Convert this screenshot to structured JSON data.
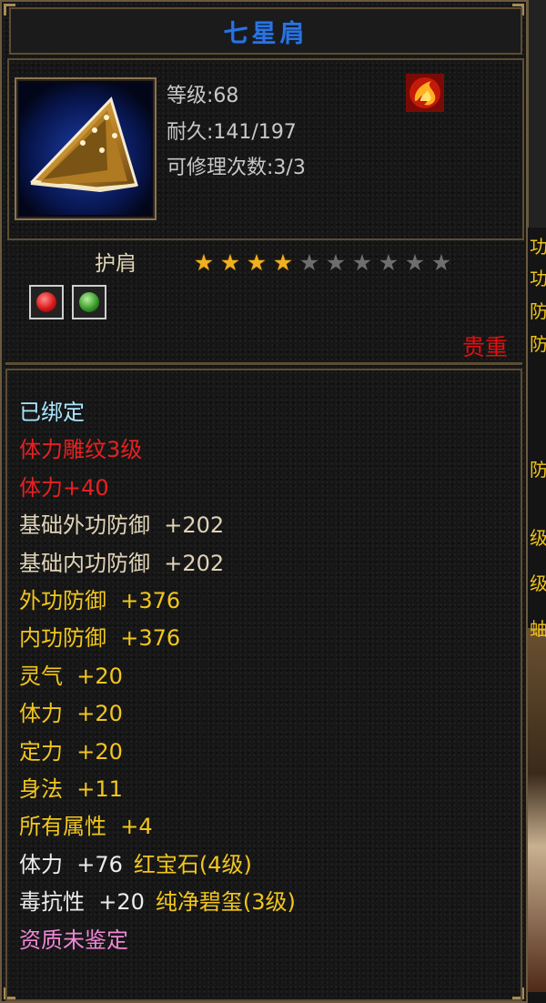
{
  "item": {
    "name": "七星肩",
    "level_line": "等级:68",
    "durability_line": "耐久:141/197",
    "repair_line": "可修理次数:3/3",
    "type": "护肩",
    "rarity": "贵重",
    "stars_total": 10,
    "stars_filled": 4,
    "icon": "shoulder-armor-icon",
    "badge_icon": "fire-element-icon",
    "gems": [
      {
        "icon": "red-gem-icon",
        "color": "#d81818"
      },
      {
        "icon": "green-gem-icon",
        "color": "#3a9a2a"
      }
    ]
  },
  "attributes": [
    {
      "text": "已绑定",
      "color": "cyan"
    },
    {
      "text": "体力雕纹3级",
      "color": "red"
    },
    {
      "text": "体力+40",
      "color": "red"
    },
    {
      "text": "基础外功防御  +202",
      "color": "beige"
    },
    {
      "text": "基础内功防御  +202",
      "color": "beige"
    },
    {
      "text": "外功防御  +376",
      "color": "gold"
    },
    {
      "text": "内功防御  +376",
      "color": "gold"
    },
    {
      "text": "灵气  +20",
      "color": "gold"
    },
    {
      "text": "体力  +20",
      "color": "gold"
    },
    {
      "text": "定力  +20",
      "color": "gold"
    },
    {
      "text": "身法  +11",
      "color": "gold"
    },
    {
      "text": "所有属性  +4",
      "color": "gold"
    },
    {
      "text": "体力  +76",
      "extra": "红宝石(4级)",
      "color": "white"
    },
    {
      "text": "毒抗性  +20",
      "extra": "纯净碧玺(3级)",
      "color": "white"
    },
    {
      "text": "资质未鉴定",
      "color": "pink"
    }
  ],
  "colors": {
    "title": "#2a74e0",
    "border": "#5b4c34",
    "rarity": "#e01010",
    "gold_text": "#f1c61e"
  },
  "side_glyphs": [
    "功",
    "功",
    "防",
    "防",
    "防",
    "级",
    "级",
    "蚰"
  ]
}
